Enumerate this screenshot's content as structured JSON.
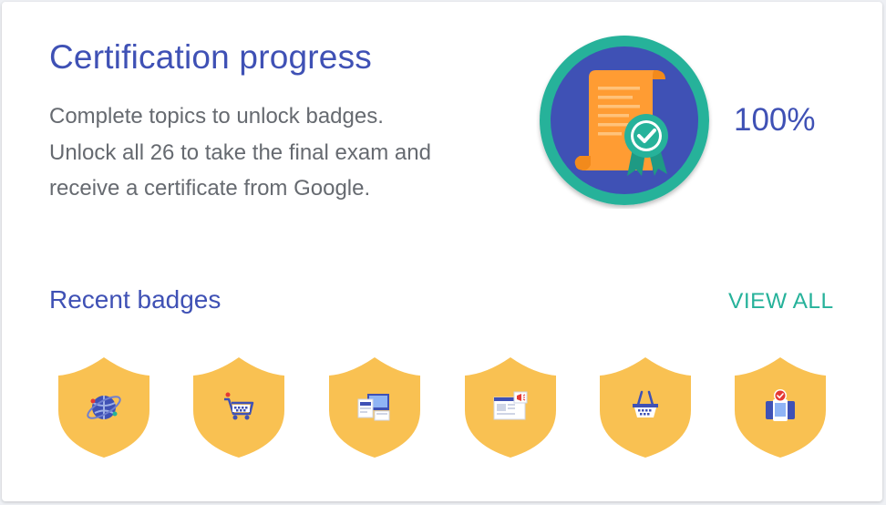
{
  "header": {
    "title": "Certification progress",
    "description_lines": [
      "Complete topics to unlock badges.",
      "Unlock all 26 to take the final exam and",
      "receive a certificate from Google."
    ]
  },
  "progress": {
    "percent_label": "100%",
    "value": 1.0
  },
  "recent": {
    "title": "Recent badges",
    "view_all_label": "VIEW ALL",
    "badges": [
      {
        "name": "globe-icon"
      },
      {
        "name": "shopping-cart-icon"
      },
      {
        "name": "devices-icon"
      },
      {
        "name": "web-ad-icon"
      },
      {
        "name": "shopping-basket-icon"
      },
      {
        "name": "mobile-check-icon"
      }
    ]
  },
  "colors": {
    "primary": "#3f51b5",
    "accent": "#26b29a",
    "text_secondary": "#666a70",
    "badge_shield": "#f9c152",
    "scroll": "#ff9c33"
  }
}
